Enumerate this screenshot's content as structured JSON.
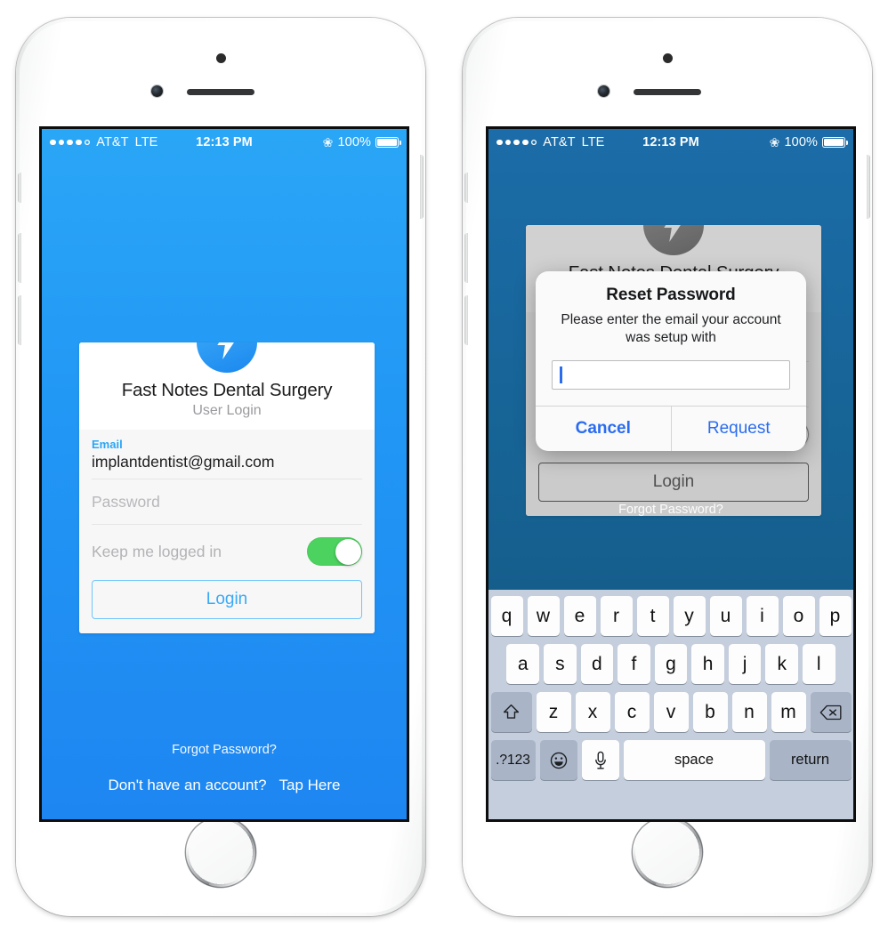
{
  "status_bar": {
    "carrier": "AT&T",
    "network": "LTE",
    "time": "12:13 PM",
    "battery_percent": "100%",
    "bluetooth_icon": "bluetooth-icon",
    "signal_dots_filled": 4,
    "signal_dots_total": 5
  },
  "login_screen": {
    "logo_icon": "lightning-bolt-icon",
    "app_title": "Fast Notes Dental Surgery",
    "app_subtitle": "User Login",
    "email_label": "Email",
    "email_value": "implantdentist@gmail.com",
    "password_placeholder": "Password",
    "keep_logged_in_label": "Keep me logged in",
    "keep_logged_in_on": true,
    "login_button": "Login",
    "forgot_password": "Forgot Password?",
    "signup_prompt": "Don't have an account?",
    "signup_action": "Tap Here"
  },
  "dialog": {
    "title": "Reset Password",
    "message": "Please enter the email your account was setup with",
    "input_value": "",
    "cancel_button": "Cancel",
    "request_button": "Request"
  },
  "keyboard": {
    "row1": [
      "q",
      "w",
      "e",
      "r",
      "t",
      "y",
      "u",
      "i",
      "o",
      "p"
    ],
    "row2": [
      "a",
      "s",
      "d",
      "f",
      "g",
      "h",
      "j",
      "k",
      "l"
    ],
    "row3": [
      "z",
      "x",
      "c",
      "v",
      "b",
      "n",
      "m"
    ],
    "shift_icon": "shift-arrow-icon",
    "backspace_icon": "backspace-icon",
    "numbers_key": ".?123",
    "emoji_icon": "smiley-face-icon",
    "dictation_icon": "microphone-icon",
    "space_key": "space",
    "return_key": "return"
  },
  "colors": {
    "accent_blue": "#2aa6f6",
    "screen_blue": "#2196f5",
    "dimmed_blue": "#15608f",
    "toggle_green": "#4cd25f",
    "dialog_button_blue": "#2a6cf0",
    "keyboard_bg": "#c5cedd"
  }
}
